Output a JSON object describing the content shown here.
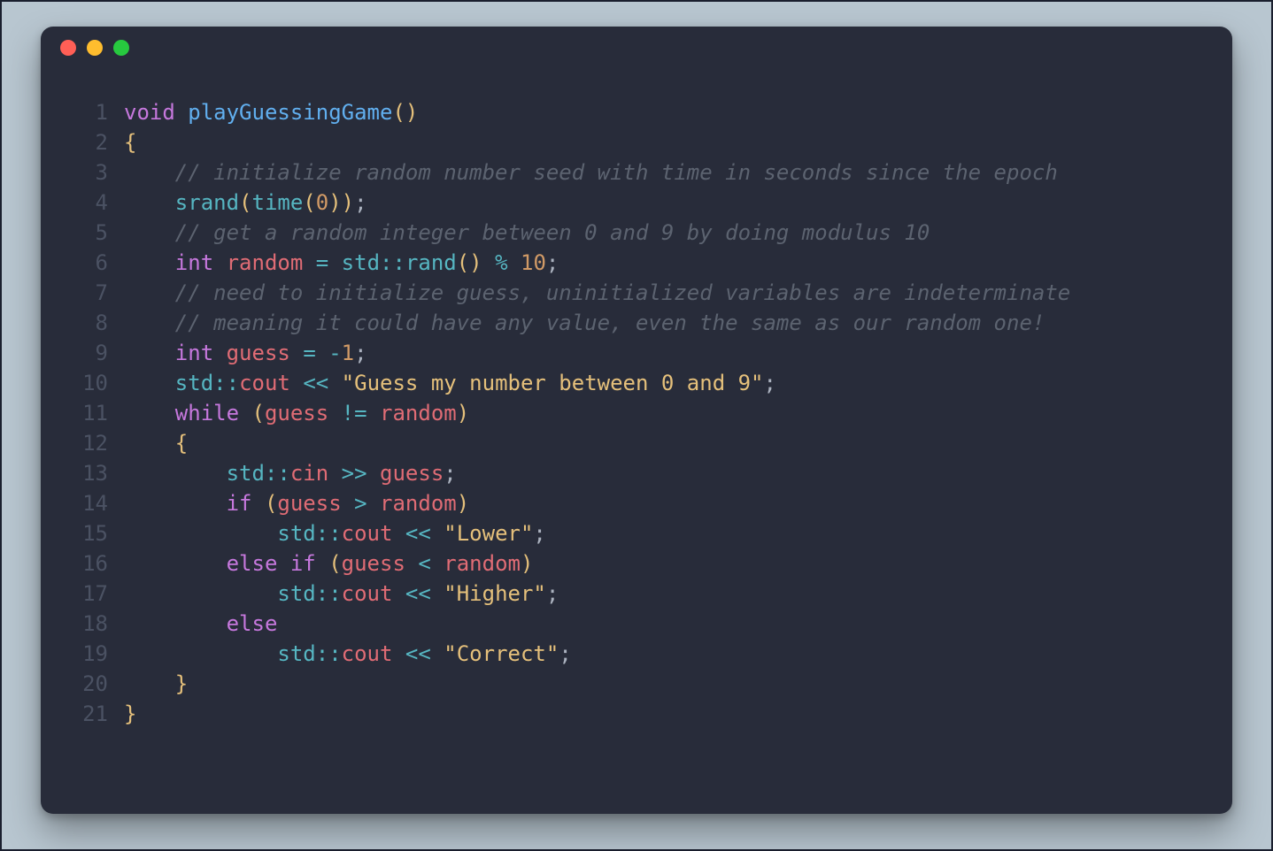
{
  "window": {
    "traffic_lights": [
      "close",
      "minimize",
      "zoom"
    ]
  },
  "code": {
    "language": "cpp",
    "line_count": 21,
    "lines": [
      {
        "n": 1,
        "indent": 0,
        "tokens": [
          {
            "cls": "tk-keyword",
            "t": "void"
          },
          {
            "cls": "tk-white",
            "t": " "
          },
          {
            "cls": "tk-func",
            "t": "playGuessingGame"
          },
          {
            "cls": "tk-paren",
            "t": "()"
          }
        ]
      },
      {
        "n": 2,
        "indent": 0,
        "tokens": [
          {
            "cls": "tk-brace",
            "t": "{"
          }
        ]
      },
      {
        "n": 3,
        "indent": 1,
        "tokens": [
          {
            "cls": "tk-comment",
            "t": "// initialize random number seed with time in seconds since the epoch"
          }
        ]
      },
      {
        "n": 4,
        "indent": 1,
        "tokens": [
          {
            "cls": "tk-call",
            "t": "srand"
          },
          {
            "cls": "tk-paren",
            "t": "("
          },
          {
            "cls": "tk-call",
            "t": "time"
          },
          {
            "cls": "tk-paren",
            "t": "("
          },
          {
            "cls": "tk-num",
            "t": "0"
          },
          {
            "cls": "tk-paren",
            "t": ")"
          },
          {
            "cls": "tk-paren",
            "t": ")"
          },
          {
            "cls": "tk-punct",
            "t": ";"
          }
        ]
      },
      {
        "n": 5,
        "indent": 1,
        "tokens": [
          {
            "cls": "tk-comment",
            "t": "// get a random integer between 0 and 9 by doing modulus 10"
          }
        ]
      },
      {
        "n": 6,
        "indent": 1,
        "tokens": [
          {
            "cls": "tk-keyword",
            "t": "int"
          },
          {
            "cls": "tk-white",
            "t": " "
          },
          {
            "cls": "tk-var",
            "t": "random"
          },
          {
            "cls": "tk-white",
            "t": " "
          },
          {
            "cls": "tk-op",
            "t": "="
          },
          {
            "cls": "tk-white",
            "t": " "
          },
          {
            "cls": "tk-ns",
            "t": "std"
          },
          {
            "cls": "tk-op",
            "t": "::"
          },
          {
            "cls": "tk-call",
            "t": "rand"
          },
          {
            "cls": "tk-paren",
            "t": "()"
          },
          {
            "cls": "tk-white",
            "t": " "
          },
          {
            "cls": "tk-op",
            "t": "%"
          },
          {
            "cls": "tk-white",
            "t": " "
          },
          {
            "cls": "tk-num",
            "t": "10"
          },
          {
            "cls": "tk-punct",
            "t": ";"
          }
        ]
      },
      {
        "n": 7,
        "indent": 1,
        "tokens": [
          {
            "cls": "tk-comment",
            "t": "// need to initialize guess, uninitialized variables are indeterminate"
          }
        ]
      },
      {
        "n": 8,
        "indent": 1,
        "tokens": [
          {
            "cls": "tk-comment",
            "t": "// meaning it could have any value, even the same as our random one!"
          }
        ]
      },
      {
        "n": 9,
        "indent": 1,
        "tokens": [
          {
            "cls": "tk-keyword",
            "t": "int"
          },
          {
            "cls": "tk-white",
            "t": " "
          },
          {
            "cls": "tk-var",
            "t": "guess"
          },
          {
            "cls": "tk-white",
            "t": " "
          },
          {
            "cls": "tk-op",
            "t": "="
          },
          {
            "cls": "tk-white",
            "t": " "
          },
          {
            "cls": "tk-op",
            "t": "-"
          },
          {
            "cls": "tk-num",
            "t": "1"
          },
          {
            "cls": "tk-punct",
            "t": ";"
          }
        ]
      },
      {
        "n": 10,
        "indent": 1,
        "tokens": [
          {
            "cls": "tk-ns",
            "t": "std"
          },
          {
            "cls": "tk-op",
            "t": "::"
          },
          {
            "cls": "tk-member",
            "t": "cout"
          },
          {
            "cls": "tk-white",
            "t": " "
          },
          {
            "cls": "tk-op",
            "t": "<<"
          },
          {
            "cls": "tk-white",
            "t": " "
          },
          {
            "cls": "tk-str",
            "t": "\"Guess my number between 0 and 9\""
          },
          {
            "cls": "tk-punct",
            "t": ";"
          }
        ]
      },
      {
        "n": 11,
        "indent": 1,
        "tokens": [
          {
            "cls": "tk-keyword",
            "t": "while"
          },
          {
            "cls": "tk-white",
            "t": " "
          },
          {
            "cls": "tk-paren",
            "t": "("
          },
          {
            "cls": "tk-var",
            "t": "guess"
          },
          {
            "cls": "tk-white",
            "t": " "
          },
          {
            "cls": "tk-op",
            "t": "!="
          },
          {
            "cls": "tk-white",
            "t": " "
          },
          {
            "cls": "tk-var",
            "t": "random"
          },
          {
            "cls": "tk-paren",
            "t": ")"
          }
        ]
      },
      {
        "n": 12,
        "indent": 1,
        "tokens": [
          {
            "cls": "tk-brace",
            "t": "{"
          }
        ]
      },
      {
        "n": 13,
        "indent": 2,
        "tokens": [
          {
            "cls": "tk-ns",
            "t": "std"
          },
          {
            "cls": "tk-op",
            "t": "::"
          },
          {
            "cls": "tk-member",
            "t": "cin"
          },
          {
            "cls": "tk-white",
            "t": " "
          },
          {
            "cls": "tk-op",
            "t": ">>"
          },
          {
            "cls": "tk-white",
            "t": " "
          },
          {
            "cls": "tk-var",
            "t": "guess"
          },
          {
            "cls": "tk-punct",
            "t": ";"
          }
        ]
      },
      {
        "n": 14,
        "indent": 2,
        "tokens": [
          {
            "cls": "tk-keyword",
            "t": "if"
          },
          {
            "cls": "tk-white",
            "t": " "
          },
          {
            "cls": "tk-paren",
            "t": "("
          },
          {
            "cls": "tk-var",
            "t": "guess"
          },
          {
            "cls": "tk-white",
            "t": " "
          },
          {
            "cls": "tk-op",
            "t": ">"
          },
          {
            "cls": "tk-white",
            "t": " "
          },
          {
            "cls": "tk-var",
            "t": "random"
          },
          {
            "cls": "tk-paren",
            "t": ")"
          }
        ]
      },
      {
        "n": 15,
        "indent": 3,
        "tokens": [
          {
            "cls": "tk-ns",
            "t": "std"
          },
          {
            "cls": "tk-op",
            "t": "::"
          },
          {
            "cls": "tk-member",
            "t": "cout"
          },
          {
            "cls": "tk-white",
            "t": " "
          },
          {
            "cls": "tk-op",
            "t": "<<"
          },
          {
            "cls": "tk-white",
            "t": " "
          },
          {
            "cls": "tk-str",
            "t": "\"Lower\""
          },
          {
            "cls": "tk-punct",
            "t": ";"
          }
        ]
      },
      {
        "n": 16,
        "indent": 2,
        "tokens": [
          {
            "cls": "tk-keyword",
            "t": "else"
          },
          {
            "cls": "tk-white",
            "t": " "
          },
          {
            "cls": "tk-keyword",
            "t": "if"
          },
          {
            "cls": "tk-white",
            "t": " "
          },
          {
            "cls": "tk-paren",
            "t": "("
          },
          {
            "cls": "tk-var",
            "t": "guess"
          },
          {
            "cls": "tk-white",
            "t": " "
          },
          {
            "cls": "tk-op",
            "t": "<"
          },
          {
            "cls": "tk-white",
            "t": " "
          },
          {
            "cls": "tk-var",
            "t": "random"
          },
          {
            "cls": "tk-paren",
            "t": ")"
          }
        ]
      },
      {
        "n": 17,
        "indent": 3,
        "tokens": [
          {
            "cls": "tk-ns",
            "t": "std"
          },
          {
            "cls": "tk-op",
            "t": "::"
          },
          {
            "cls": "tk-member",
            "t": "cout"
          },
          {
            "cls": "tk-white",
            "t": " "
          },
          {
            "cls": "tk-op",
            "t": "<<"
          },
          {
            "cls": "tk-white",
            "t": " "
          },
          {
            "cls": "tk-str",
            "t": "\"Higher\""
          },
          {
            "cls": "tk-punct",
            "t": ";"
          }
        ]
      },
      {
        "n": 18,
        "indent": 2,
        "tokens": [
          {
            "cls": "tk-keyword",
            "t": "else"
          }
        ]
      },
      {
        "n": 19,
        "indent": 3,
        "tokens": [
          {
            "cls": "tk-ns",
            "t": "std"
          },
          {
            "cls": "tk-op",
            "t": "::"
          },
          {
            "cls": "tk-member",
            "t": "cout"
          },
          {
            "cls": "tk-white",
            "t": " "
          },
          {
            "cls": "tk-op",
            "t": "<<"
          },
          {
            "cls": "tk-white",
            "t": " "
          },
          {
            "cls": "tk-str",
            "t": "\"Correct\""
          },
          {
            "cls": "tk-punct",
            "t": ";"
          }
        ]
      },
      {
        "n": 20,
        "indent": 1,
        "tokens": [
          {
            "cls": "tk-brace",
            "t": "}"
          }
        ]
      },
      {
        "n": 21,
        "indent": 0,
        "tokens": [
          {
            "cls": "tk-brace",
            "t": "}"
          }
        ]
      }
    ]
  }
}
